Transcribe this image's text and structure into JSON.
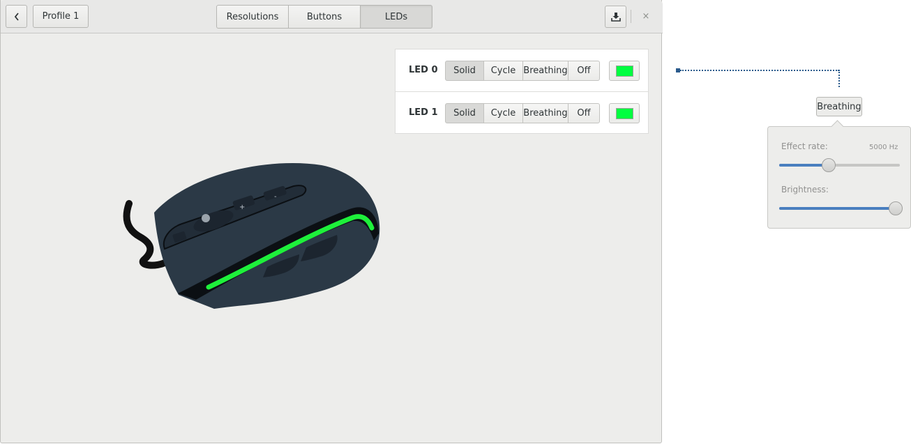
{
  "header": {
    "profile_label": "Profile 1",
    "tabs": [
      {
        "label": "Resolutions",
        "active": false
      },
      {
        "label": "Buttons",
        "active": false
      },
      {
        "label": "LEDs",
        "active": true
      }
    ],
    "close_symbol": "×",
    "icons": {
      "back": "chevron-left-icon",
      "download": "download-icon",
      "close": "close-icon"
    }
  },
  "leds": [
    {
      "label": "LED 0",
      "modes": [
        "Solid",
        "Cycle",
        "Breathing",
        "Off"
      ],
      "active_mode": "Solid",
      "color": "#00ff40"
    },
    {
      "label": "LED 1",
      "modes": [
        "Solid",
        "Cycle",
        "Breathing",
        "Off"
      ],
      "active_mode": "Solid",
      "color": "#00ff40"
    }
  ],
  "popover": {
    "trigger_label": "Breathing",
    "effect_rate_label": "Effect rate:",
    "effect_rate_value": "5000 Hz",
    "effect_rate_fraction": 0.39,
    "brightness_label": "Brightness:",
    "brightness_fraction": 1.0
  },
  "colors": {
    "accent": "#4a7fbf",
    "led_green": "#00ff40",
    "mouse_body": "#2b3946"
  }
}
